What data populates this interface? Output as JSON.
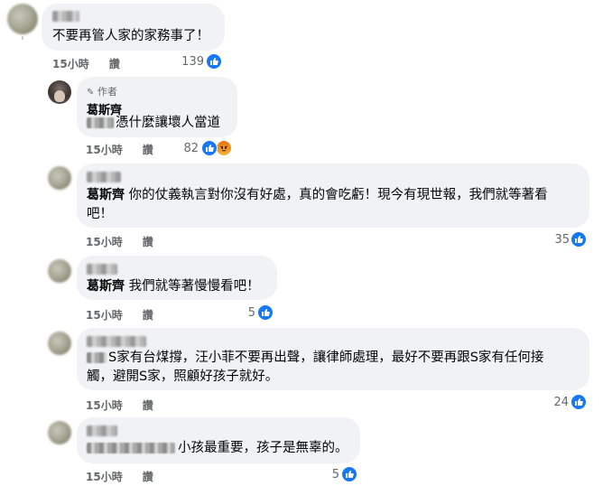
{
  "comments": [
    {
      "text": "不要再管人家的家務事了！",
      "time": "15小時",
      "like_label": "讚",
      "reactions": "139"
    },
    {
      "author_badge": "作者",
      "author_name": "葛斯齊",
      "text": "憑什麼讓壞人當道",
      "time": "15小時",
      "like_label": "讚",
      "reactions": "82"
    },
    {
      "mention": "葛斯齊",
      "text_line1": "你的仗義執言對你沒有好處，真的會吃虧！現今有現世報，我們就等著看",
      "text_line2": "吧！",
      "time": "15小時",
      "like_label": "讚",
      "reactions": "35"
    },
    {
      "mention": "葛斯齊",
      "text": "我們就等著慢慢看吧！",
      "time": "15小時",
      "like_label": "讚",
      "reactions": "5"
    },
    {
      "text_line1": "S家有台煤撐，汪小菲不要再出聲，讓律師處理，最好不要再跟S家有任何接",
      "text_line2": "觸，避開S家，照顧好孩子就好。",
      "time": "15小時",
      "like_label": "讚",
      "reactions": "24"
    },
    {
      "text": "小孩最重要，孩子是無辜的。",
      "time": "15小時",
      "like_label": "讚",
      "reactions": "5"
    }
  ],
  "icons": {
    "like": "thumbs-up-icon",
    "angry": "angry-face-icon",
    "pencil": "pencil-icon"
  },
  "colors": {
    "bubble": "#f0f2f5",
    "like_blue": "#1877f2",
    "meta_grey": "#65676b"
  }
}
